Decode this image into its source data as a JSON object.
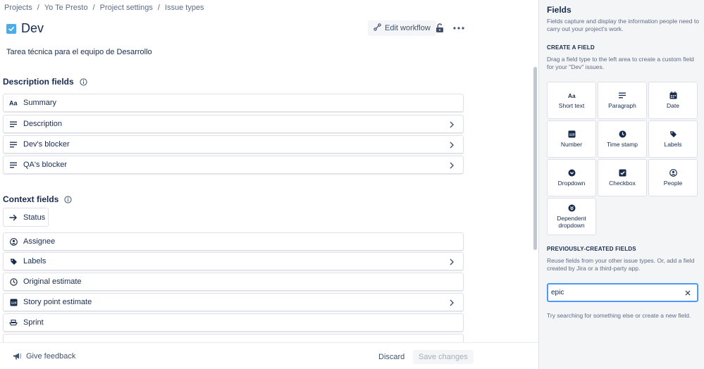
{
  "breadcrumb": [
    "Projects",
    "Yo Te Presto",
    "Project settings",
    "Issue types"
  ],
  "page": {
    "title": "Dev",
    "description": "Tarea técnica para el equipo de Desarrollo",
    "edit_workflow_label": "Edit workflow"
  },
  "description_fields": {
    "heading": "Description fields",
    "items": [
      {
        "label": "Summary",
        "icon": "short-text-icon",
        "chevron": false
      },
      {
        "label": "Description",
        "icon": "paragraph-icon",
        "chevron": true
      },
      {
        "label": "Dev's blocker",
        "icon": "paragraph-icon",
        "chevron": true
      },
      {
        "label": "QA's blocker",
        "icon": "paragraph-icon",
        "chevron": true
      }
    ]
  },
  "context_fields": {
    "heading": "Context fields",
    "status_label": "Status",
    "items": [
      {
        "label": "Assignee",
        "icon": "people-icon",
        "chevron": false
      },
      {
        "label": "Labels",
        "icon": "label-icon",
        "chevron": true
      },
      {
        "label": "Original estimate",
        "icon": "clock-icon",
        "chevron": false
      },
      {
        "label": "Story point estimate",
        "icon": "number-icon",
        "chevron": true
      },
      {
        "label": "Sprint",
        "icon": "sprint-icon",
        "chevron": false
      }
    ]
  },
  "footer": {
    "feedback_label": "Give feedback",
    "discard_label": "Discard",
    "save_label": "Save changes"
  },
  "panel": {
    "title": "Fields",
    "description": "Fields capture and display the information people need to carry out your project's work.",
    "create_heading": "CREATE A FIELD",
    "create_note": "Drag a field type to the left area to create a custom field for your \"Dev\" issues.",
    "field_types": [
      {
        "label": "Short text",
        "icon": "short-text-icon"
      },
      {
        "label": "Paragraph",
        "icon": "paragraph-icon"
      },
      {
        "label": "Date",
        "icon": "calendar-icon"
      },
      {
        "label": "Number",
        "icon": "number-icon"
      },
      {
        "label": "Time stamp",
        "icon": "clock-icon"
      },
      {
        "label": "Labels",
        "icon": "label-icon"
      },
      {
        "label": "Dropdown",
        "icon": "dropdown-icon"
      },
      {
        "label": "Checkbox",
        "icon": "checkbox-icon"
      },
      {
        "label": "People",
        "icon": "people-icon"
      },
      {
        "label": "Dependent dropdown",
        "icon": "dependent-dropdown-icon"
      }
    ],
    "previous_heading": "PREVIOUSLY-CREATED FIELDS",
    "previous_note": "Reuse fields from your other issue types. Or, add a field created by Jira or a third-party app.",
    "search_value": "epic",
    "empty_message": "Try searching for something else or create a new field."
  },
  "colors": {
    "accent": "#4C9AFF",
    "issue_type": "#4BADE8",
    "panel_bg": "#F4F5F7",
    "text": "#172B4D"
  }
}
